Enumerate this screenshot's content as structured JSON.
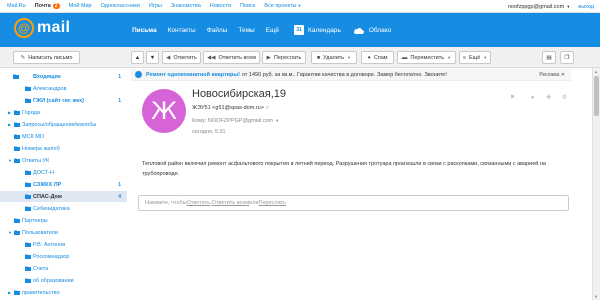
{
  "portal": {
    "links": [
      {
        "label": "Mail.Ru"
      },
      {
        "label": "Почта",
        "badge": "2"
      },
      {
        "label": "Мой Мир"
      },
      {
        "label": "Одноклассники"
      },
      {
        "label": "Игры"
      },
      {
        "label": "Знакомства"
      },
      {
        "label": "Новости"
      },
      {
        "label": "Поиск"
      },
      {
        "label": "Все проекты"
      }
    ],
    "user_email": "noofzppgp@gmail.com",
    "exit_label": "выход"
  },
  "header": {
    "logo_text": "mail",
    "nav": [
      "Письма",
      "Контакты",
      "Файлы",
      "Темы",
      "Ещё"
    ],
    "calendar_label": "Календарь",
    "calendar_icon_text": "31",
    "cloud_label": "Облако"
  },
  "toolbar": {
    "compose": "Написать письмо",
    "reply": "Ответить",
    "reply_all": "Ответить всем",
    "forward": "Переслать",
    "delete": "Удалить",
    "spam": "Спам",
    "move": "Переместить",
    "more": "Ещё"
  },
  "sidebar": {
    "folders": [
      {
        "label": "Входящие",
        "count": "1"
      },
      {
        "label": "Александров",
        "count": ""
      },
      {
        "label": "ГЖИ (сайт гис жкх)",
        "count": "1"
      },
      {
        "label": "Города",
        "count": ""
      },
      {
        "label": "Запросы/обращения/жалобы",
        "count": ""
      },
      {
        "label": "МСК МО",
        "count": ""
      },
      {
        "label": "Номера жалоб",
        "count": ""
      },
      {
        "label": "Ответы УК",
        "count": ""
      },
      {
        "label": "ДОСТ-Н",
        "count": ""
      },
      {
        "label": "СЗЖКХ ЛР",
        "count": "1"
      },
      {
        "label": "СПАС-Дом",
        "count": "4"
      },
      {
        "label": "Себинидатика",
        "count": ""
      },
      {
        "label": "Партнеры",
        "count": ""
      },
      {
        "label": "Пользователи",
        "count": ""
      },
      {
        "label": "Р.В. Антонов",
        "count": ""
      },
      {
        "label": "Роскомнадзор",
        "count": ""
      },
      {
        "label": "Счета",
        "count": ""
      },
      {
        "label": "об образовании",
        "count": ""
      },
      {
        "label": "правительство",
        "count": ""
      }
    ]
  },
  "promo": {
    "title": "Ремонт однокомнатной квартиры!",
    "text": "от 1490 руб. за кв.м.. Гарантии качества в договоре. Замер бесплатно. Звоните!",
    "ad_label": "Реклама"
  },
  "message": {
    "avatar_letter": "Ж",
    "subject": "Новосибирская,19",
    "sender": "ЖЭУ51 <g51@spas-dom.ru>",
    "to": "Кому: NOOFZPPGP@gmail.com",
    "date": "сегодня, 5:31",
    "body": "Тепловой район включил ремонт асфальтового покрытия в летний период. Разрушения тротуара произошли в связи с раскопками, связанными с аварией на трубопроводе."
  },
  "reply_box": {
    "prefix": "Нажмите, чтобы ",
    "reply": "Ответить",
    "sep1": ", ",
    "reply_all": "Ответить всем",
    "sep2": " или ",
    "forward": "Переслать"
  },
  "colors": {
    "brand_blue": "#168de2",
    "logo_orange": "#ff9e00",
    "avatar": "#d763d8",
    "badge": "#ff6a00"
  }
}
